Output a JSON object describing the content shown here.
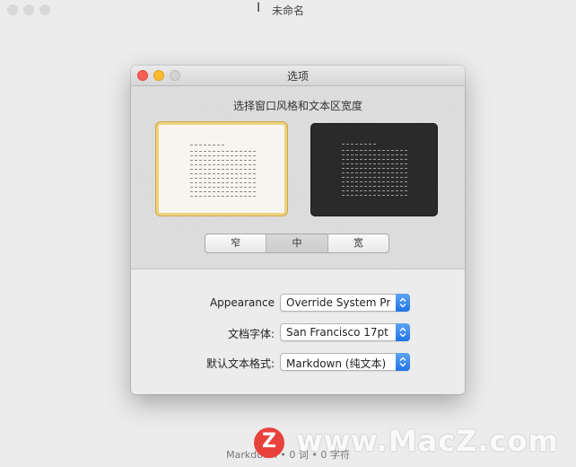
{
  "background_window": {
    "title": "未命名",
    "status": "Markdown • 0 词 • 0 字符"
  },
  "dialog": {
    "title": "选项",
    "section_heading": "选择窗口风格和文本区宽度",
    "themes": [
      {
        "name": "light",
        "selected": true
      },
      {
        "name": "dark",
        "selected": false
      }
    ],
    "width_segments": [
      {
        "label": "窄",
        "selected": false
      },
      {
        "label": "中",
        "selected": true
      },
      {
        "label": "宽",
        "selected": false
      }
    ],
    "appearance": {
      "label": "Appearance",
      "value": "Override System Pref..."
    },
    "font": {
      "label": "文档字体:",
      "value": "San Francisco 17pt"
    },
    "format": {
      "label": "默认文本格式:",
      "value": "Markdown (纯文本)"
    }
  },
  "watermark": {
    "logo": "Z",
    "text": "www.MacZ.com"
  },
  "colors": {
    "close": "#fc5f57",
    "minimize": "#fdbc2e",
    "accent": "#1f74e6",
    "selected_theme_border": "#ecd27f"
  }
}
